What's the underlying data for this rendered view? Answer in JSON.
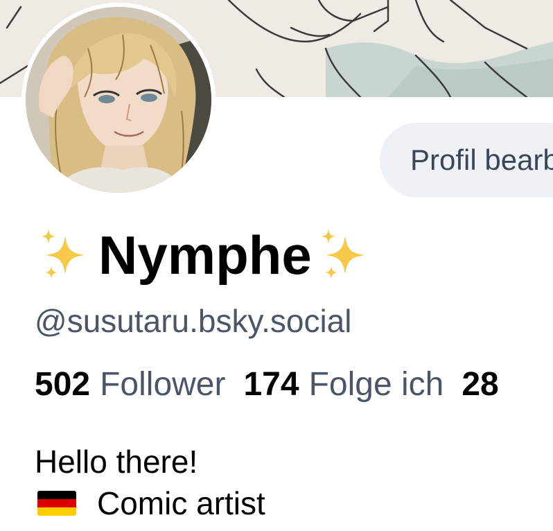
{
  "profile": {
    "display_name": "Nymphe",
    "name_decoration_icon": "sparkles-icon",
    "handle": "@susutaru.bsky.social",
    "edit_button_label": "Profil bearbeiten",
    "stats": {
      "followers_count": "502",
      "followers_label": "Follower",
      "following_count": "174",
      "following_label": "Folge ich",
      "posts_count": "28"
    },
    "bio": {
      "line1": "Hello there!",
      "line2_icon": "germany-flag-icon",
      "line2": "Comic artist"
    }
  },
  "colors": {
    "button_bg": "#eef2f6",
    "muted_text": "#4a5568",
    "sparkle": "#f5c518"
  }
}
